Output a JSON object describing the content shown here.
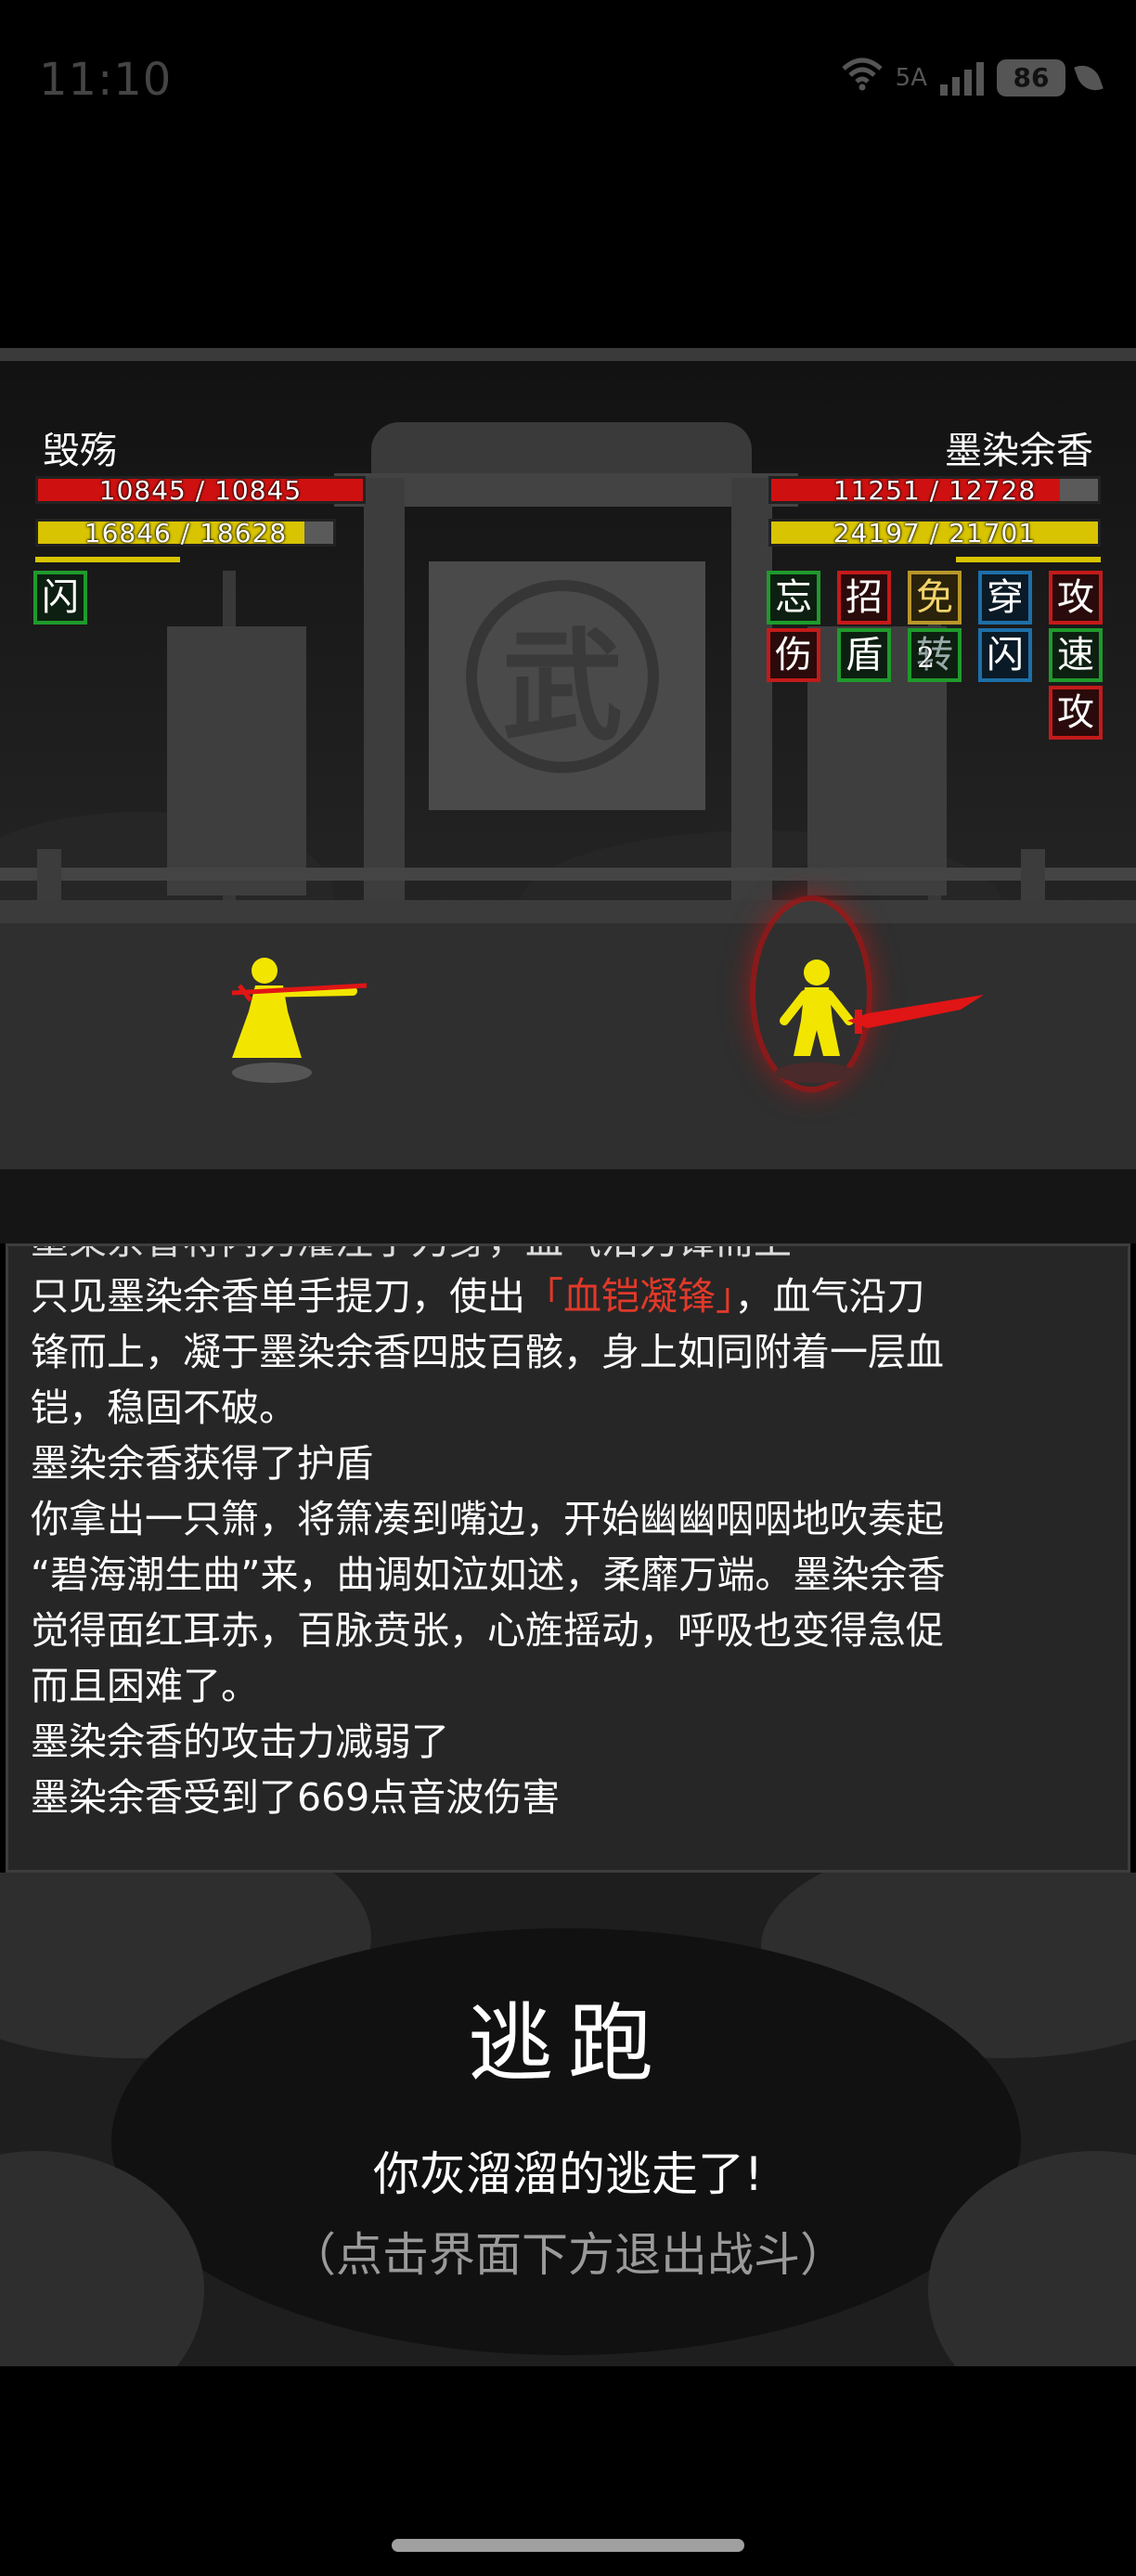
{
  "status_bar": {
    "time": "11:10",
    "network": "5A",
    "wifi_sub": "6",
    "battery": "86"
  },
  "player": {
    "name": "毁殇",
    "hp": "10845 / 10845",
    "hp_fraction": 1.0,
    "mp": "16846 / 18628",
    "mp_fraction": 0.904,
    "statuses": [
      "闪"
    ]
  },
  "enemy": {
    "name": "墨染余香",
    "hp": "11251 / 12728",
    "hp_fraction": 0.884,
    "mp": "24197 / 21701",
    "mp_fraction": 1.0,
    "statuses": [
      "忘",
      "招",
      "免",
      "穿",
      "攻",
      "伤",
      "盾",
      "转",
      "闪",
      "速",
      "攻"
    ],
    "status_count": "2"
  },
  "battle_log": {
    "clipped_line": "墨染余香将内力灌注于刀身，血气沿刀锋而上",
    "line1_prefix": "只见墨染余香单手提刀，使出",
    "skill_name": "「血铠凝锋」",
    "line1_suffix": "，血气沿刀",
    "line2": "锋而上，凝于墨染余香四肢百骸，身上如同附着一层血",
    "line3": "铠，稳固不破。",
    "line4": "墨染余香获得了护盾",
    "line5": "你拿出一只箫，将箫凑到嘴边，开始幽幽咽咽地吹奏起",
    "line6": "“碧海潮生曲”来，曲调如泣如述，柔靡万端。墨染余香",
    "line7": "觉得面红耳赤，百脉贲张，心旌摇动，呼吸也变得急促",
    "line8": "而且困难了。",
    "line9": "墨染余香的攻击力减弱了",
    "line10": "墨染余香受到了669点音波伤害"
  },
  "escape": {
    "title": "逃跑",
    "message": "你灰溜溜的逃走了!",
    "hint": "（点击界面下方退出战斗）"
  },
  "colors": {
    "hp": "#cf1010",
    "mp": "#d8c400",
    "highlight": "#e0392a",
    "fighter": "#f2e600",
    "weapon": "#e01515"
  }
}
